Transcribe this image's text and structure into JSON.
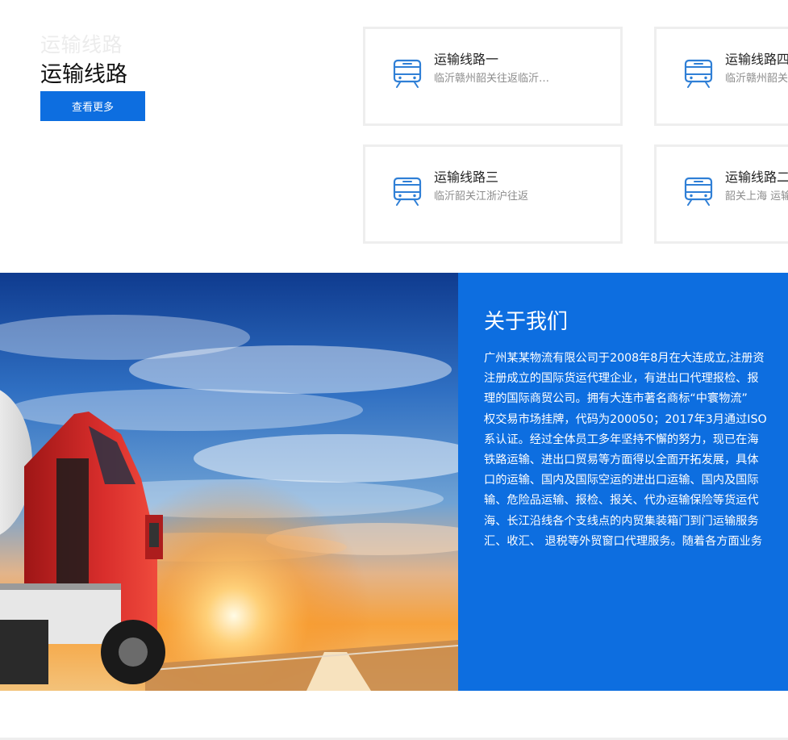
{
  "routes_section": {
    "ghost_title": "运输线路",
    "title": "运输线路",
    "more_button": "查看更多",
    "cards": [
      {
        "name": "运输线路一",
        "desc": "临沂赣州韶关往返临沂…",
        "icon": "train-icon"
      },
      {
        "name": "运输线路四",
        "desc": "临沂赣州韶关往返",
        "icon": "train-icon"
      },
      {
        "name": "运输线路三",
        "desc": "临沂韶关江浙沪往返",
        "icon": "train-icon"
      },
      {
        "name": "运输线路二",
        "desc": "韶关上海 运输",
        "icon": "train-icon"
      }
    ]
  },
  "about_section": {
    "title": "关于我们",
    "lines": [
      "广州某某物流有限公司于2008年8月在大连成立,注册资",
      "注册成立的国际货运代理企业，有进出口代理报检、报",
      "理的国际商贸公司。拥有大连市著名商标“中寰物流”",
      "权交易市场挂牌，代码为200050；2017年3月通过ISO",
      "系认证。经过全体员工多年坚持不懈的努力，现已在海",
      "铁路运输、进出口贸易等方面得以全面开拓发展，具体",
      "口的运输、国内及国际空运的进出口运输、国内及国际",
      "输、危险品运输、报检、报关、代办运输保险等货运代",
      "海、长江沿线各个支线点的内贸集装箱门到门运输服务",
      "汇、收汇、 退税等外贸窗口代理服务。随着各方面业务"
    ]
  },
  "colors": {
    "accent": "#0d6ee0",
    "card_border": "#eeeeee",
    "icon_stroke": "#2f7fd6"
  }
}
